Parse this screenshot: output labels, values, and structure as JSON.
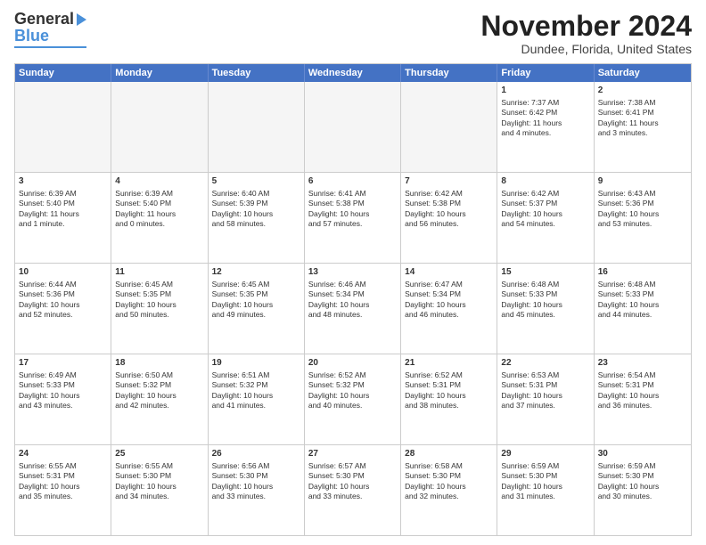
{
  "header": {
    "logo_line1": "General",
    "logo_line2": "Blue",
    "month": "November 2024",
    "location": "Dundee, Florida, United States"
  },
  "days_of_week": [
    "Sunday",
    "Monday",
    "Tuesday",
    "Wednesday",
    "Thursday",
    "Friday",
    "Saturday"
  ],
  "weeks": [
    [
      {
        "day": "",
        "info": "",
        "empty": true
      },
      {
        "day": "",
        "info": "",
        "empty": true
      },
      {
        "day": "",
        "info": "",
        "empty": true
      },
      {
        "day": "",
        "info": "",
        "empty": true
      },
      {
        "day": "",
        "info": "",
        "empty": true
      },
      {
        "day": "1",
        "info": "Sunrise: 7:37 AM\nSunset: 6:42 PM\nDaylight: 11 hours\nand 4 minutes."
      },
      {
        "day": "2",
        "info": "Sunrise: 7:38 AM\nSunset: 6:41 PM\nDaylight: 11 hours\nand 3 minutes."
      }
    ],
    [
      {
        "day": "3",
        "info": "Sunrise: 6:39 AM\nSunset: 5:40 PM\nDaylight: 11 hours\nand 1 minute."
      },
      {
        "day": "4",
        "info": "Sunrise: 6:39 AM\nSunset: 5:40 PM\nDaylight: 11 hours\nand 0 minutes."
      },
      {
        "day": "5",
        "info": "Sunrise: 6:40 AM\nSunset: 5:39 PM\nDaylight: 10 hours\nand 58 minutes."
      },
      {
        "day": "6",
        "info": "Sunrise: 6:41 AM\nSunset: 5:38 PM\nDaylight: 10 hours\nand 57 minutes."
      },
      {
        "day": "7",
        "info": "Sunrise: 6:42 AM\nSunset: 5:38 PM\nDaylight: 10 hours\nand 56 minutes."
      },
      {
        "day": "8",
        "info": "Sunrise: 6:42 AM\nSunset: 5:37 PM\nDaylight: 10 hours\nand 54 minutes."
      },
      {
        "day": "9",
        "info": "Sunrise: 6:43 AM\nSunset: 5:36 PM\nDaylight: 10 hours\nand 53 minutes."
      }
    ],
    [
      {
        "day": "10",
        "info": "Sunrise: 6:44 AM\nSunset: 5:36 PM\nDaylight: 10 hours\nand 52 minutes."
      },
      {
        "day": "11",
        "info": "Sunrise: 6:45 AM\nSunset: 5:35 PM\nDaylight: 10 hours\nand 50 minutes."
      },
      {
        "day": "12",
        "info": "Sunrise: 6:45 AM\nSunset: 5:35 PM\nDaylight: 10 hours\nand 49 minutes."
      },
      {
        "day": "13",
        "info": "Sunrise: 6:46 AM\nSunset: 5:34 PM\nDaylight: 10 hours\nand 48 minutes."
      },
      {
        "day": "14",
        "info": "Sunrise: 6:47 AM\nSunset: 5:34 PM\nDaylight: 10 hours\nand 46 minutes."
      },
      {
        "day": "15",
        "info": "Sunrise: 6:48 AM\nSunset: 5:33 PM\nDaylight: 10 hours\nand 45 minutes."
      },
      {
        "day": "16",
        "info": "Sunrise: 6:48 AM\nSunset: 5:33 PM\nDaylight: 10 hours\nand 44 minutes."
      }
    ],
    [
      {
        "day": "17",
        "info": "Sunrise: 6:49 AM\nSunset: 5:33 PM\nDaylight: 10 hours\nand 43 minutes."
      },
      {
        "day": "18",
        "info": "Sunrise: 6:50 AM\nSunset: 5:32 PM\nDaylight: 10 hours\nand 42 minutes."
      },
      {
        "day": "19",
        "info": "Sunrise: 6:51 AM\nSunset: 5:32 PM\nDaylight: 10 hours\nand 41 minutes."
      },
      {
        "day": "20",
        "info": "Sunrise: 6:52 AM\nSunset: 5:32 PM\nDaylight: 10 hours\nand 40 minutes."
      },
      {
        "day": "21",
        "info": "Sunrise: 6:52 AM\nSunset: 5:31 PM\nDaylight: 10 hours\nand 38 minutes."
      },
      {
        "day": "22",
        "info": "Sunrise: 6:53 AM\nSunset: 5:31 PM\nDaylight: 10 hours\nand 37 minutes."
      },
      {
        "day": "23",
        "info": "Sunrise: 6:54 AM\nSunset: 5:31 PM\nDaylight: 10 hours\nand 36 minutes."
      }
    ],
    [
      {
        "day": "24",
        "info": "Sunrise: 6:55 AM\nSunset: 5:31 PM\nDaylight: 10 hours\nand 35 minutes."
      },
      {
        "day": "25",
        "info": "Sunrise: 6:55 AM\nSunset: 5:30 PM\nDaylight: 10 hours\nand 34 minutes."
      },
      {
        "day": "26",
        "info": "Sunrise: 6:56 AM\nSunset: 5:30 PM\nDaylight: 10 hours\nand 33 minutes."
      },
      {
        "day": "27",
        "info": "Sunrise: 6:57 AM\nSunset: 5:30 PM\nDaylight: 10 hours\nand 33 minutes."
      },
      {
        "day": "28",
        "info": "Sunrise: 6:58 AM\nSunset: 5:30 PM\nDaylight: 10 hours\nand 32 minutes."
      },
      {
        "day": "29",
        "info": "Sunrise: 6:59 AM\nSunset: 5:30 PM\nDaylight: 10 hours\nand 31 minutes."
      },
      {
        "day": "30",
        "info": "Sunrise: 6:59 AM\nSunset: 5:30 PM\nDaylight: 10 hours\nand 30 minutes."
      }
    ]
  ]
}
